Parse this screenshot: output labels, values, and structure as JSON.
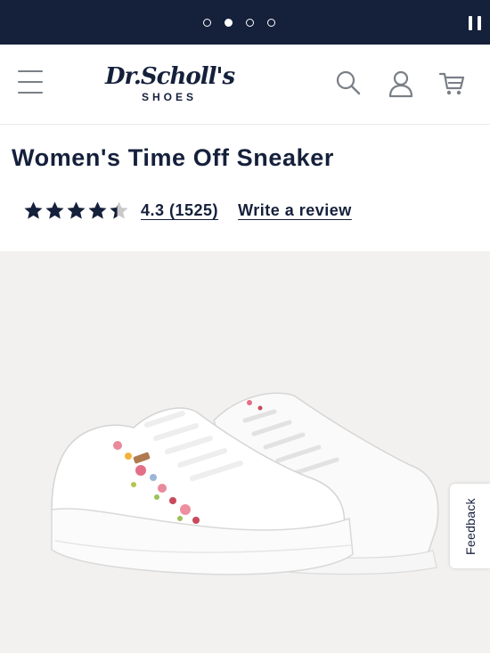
{
  "promo_bar": {
    "carousel_dots": 4,
    "active_dot": 1,
    "pause_label": ""
  },
  "header": {
    "logo_main": "Dr.Scholl's",
    "logo_sub": "SHOES",
    "icons": [
      "menu-icon",
      "search-icon",
      "account-icon",
      "cart-icon"
    ]
  },
  "product": {
    "title": "Women's Time Off Sneaker",
    "rating_value": 4.3,
    "rating_text": "4.3 (1525)",
    "write_review": "Write a review",
    "image_alt": "White platform sneaker with floral embroidery"
  },
  "feedback": {
    "label": "Feedback"
  },
  "colors": {
    "navy": "#15203b",
    "gallery_bg": "#f2f1f0",
    "star_full": "#15203b",
    "star_empty": "#c9c9c9"
  }
}
